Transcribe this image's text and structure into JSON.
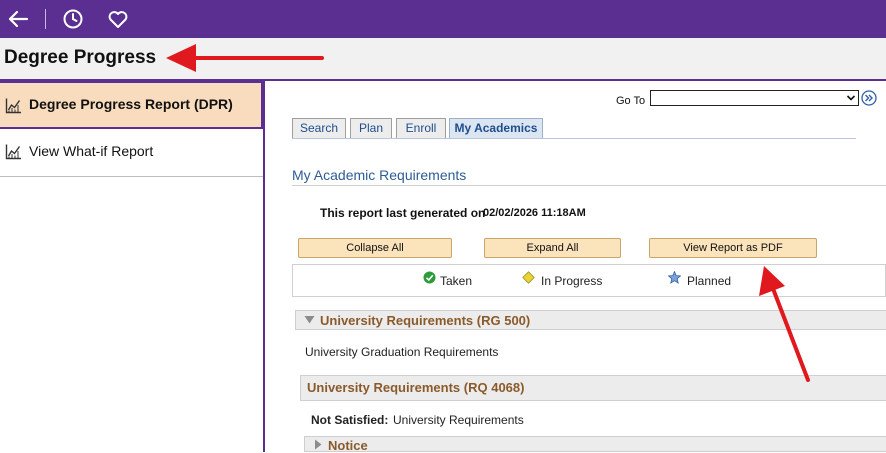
{
  "header": {
    "page_title": "Degree Progress"
  },
  "sidebar": {
    "items": [
      {
        "label": "Degree Progress Report (DPR)"
      },
      {
        "label": "View What-if Report"
      }
    ]
  },
  "goto": {
    "label": "Go To",
    "selected": ""
  },
  "tabs": [
    {
      "label": "Search"
    },
    {
      "label": "Plan"
    },
    {
      "label": "Enroll"
    },
    {
      "label": "My Academics"
    }
  ],
  "main": {
    "heading": "My Academic Requirements",
    "generated_label": "This report last generated on",
    "generated_value": "02/02/2026 11:18AM",
    "buttons": {
      "collapse": "Collapse All",
      "expand": "Expand All",
      "pdf": "View Report as PDF"
    },
    "legend": {
      "taken": "Taken",
      "in_progress": "In Progress",
      "planned": "Planned"
    },
    "sections": {
      "rg_title": "University Requirements (RG 500)",
      "rg_desc": "University Graduation Requirements",
      "rq_title": "University Requirements (RQ 4068)",
      "status_label": "Not Satisfied:",
      "status_value": "University Requirements",
      "notice": "Notice"
    }
  },
  "colors": {
    "brand_purple": "#5b2e91",
    "active_sidebar": "#f8dcbd",
    "annotation_arrow": "#e0191e",
    "section_title": "#8a5a2b"
  }
}
